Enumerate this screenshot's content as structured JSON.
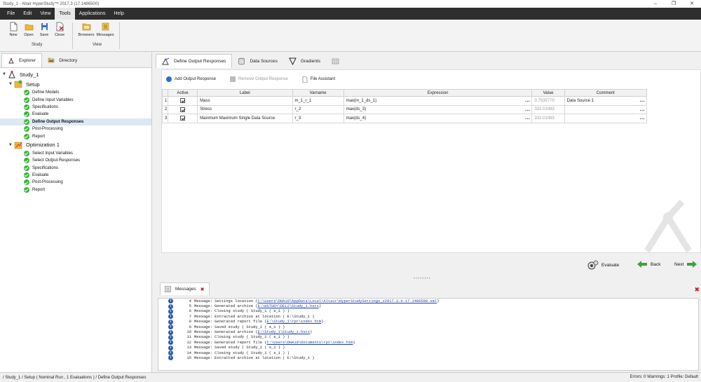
{
  "window": {
    "title": "Study_1 - Altair HyperStudy™ 2017.3 (17.1486500)"
  },
  "menu": [
    "File",
    "Edit",
    "View",
    "Tools",
    "Applications",
    "Help"
  ],
  "toolbar": {
    "study_buttons": [
      "New",
      "Open",
      "Save",
      "Close"
    ],
    "study_group": "Study",
    "view_buttons": [
      "Browsers",
      "Messages"
    ],
    "view_group": "View"
  },
  "left_tabs": [
    "Explorer",
    "Directory"
  ],
  "tree": {
    "root": "Study_1",
    "setup": {
      "label": "Setup",
      "items": [
        "Define Models",
        "Define Input Variables",
        "Specifications",
        "Evaluate",
        "Define Output Responses",
        "Post-Processing",
        "Report"
      ]
    },
    "optimization": {
      "label": "Optimization 1",
      "items": [
        "Select Input Variables",
        "Select Output Responses",
        "Specifications",
        "Evaluate",
        "Post-Processing",
        "Report"
      ]
    }
  },
  "main_tabs": [
    "Define Output Responses",
    "Data Sources",
    "Gradients"
  ],
  "actions": {
    "add": "Add Output Response",
    "remove": "Remove Output Response",
    "file_assistant": "File Assistant"
  },
  "grid": {
    "headers": [
      "Active",
      "Label",
      "Varname",
      "Expression",
      "Value",
      "Comment"
    ],
    "rows": [
      {
        "num": "1",
        "label": "Mass",
        "varname": "m_1_r_1",
        "expression": "max(m_1_ds_1)",
        "value": "0.7535770",
        "comment": "Data Source 1"
      },
      {
        "num": "2",
        "label": "Stress",
        "varname": "r_2",
        "expression": "max(ds_3)",
        "value": "332.01083",
        "comment": ""
      },
      {
        "num": "3",
        "label": "Maximum Maximum Single Data Source",
        "varname": "r_3",
        "expression": "max(ds_4)",
        "value": "332.01083",
        "comment": ""
      }
    ],
    "dots": "..."
  },
  "nav": {
    "evaluate": "Evaluate",
    "back": "Back",
    "next": "Next"
  },
  "messages": {
    "tab": "Messages",
    "lines": [
      {
        "n": "4",
        "pre": "Message: Settings location ( ",
        "link": "C:\\Users\\DHA10\\AppData\\Local\\Altair\\HyperStudySettings_v2017.3.0.17.1486500.xml",
        "post": " )"
      },
      {
        "n": "5",
        "pre": "Message: Generated archive ( ",
        "link": "E:\\HSTUDY\\DEL2\\Study_1.hstx",
        "post": " )"
      },
      {
        "n": "6",
        "pre": "Message: Closing study ( Study_1 ( s_1 ) )",
        "link": "",
        "post": ""
      },
      {
        "n": "7",
        "pre": "Message: Extracted archive at location ( E:\\Study_1 )",
        "link": "",
        "post": ""
      },
      {
        "n": "8",
        "pre": "Message: Generated report file ( ",
        "link": "E:\\Study_1\\rpt\\index.htm",
        "post": " )"
      },
      {
        "n": "9",
        "pre": "Message: Saved study ( Study_1 ( s_1 ) )",
        "link": "",
        "post": ""
      },
      {
        "n": "10",
        "pre": "Message: Generated archive ( ",
        "link": "E:\\Study_1\\Study_1.hstx",
        "post": " )"
      },
      {
        "n": "11",
        "pre": "Message: Closing study ( Study_1 ( s_1 ) )",
        "link": "",
        "post": ""
      },
      {
        "n": "12",
        "pre": "Message: Generated report file ( ",
        "link": "C:\\Users\\DHA10\\Documents\\rpt\\index.htm",
        "post": " )"
      },
      {
        "n": "13",
        "pre": "Message: Saved study ( Study_1 ( s_1 ) )",
        "link": "",
        "post": ""
      },
      {
        "n": "14",
        "pre": "Message: Closing study ( Study_1 ( s_1 ) )",
        "link": "",
        "post": ""
      },
      {
        "n": "15",
        "pre": "Message: Extracted archive at location ( E:\\Study_1 )",
        "link": "",
        "post": ""
      }
    ]
  },
  "status": {
    "path": "/ Study_1 / Setup ( Nominal Run , 1 Evaluations ) / Define Output Responses",
    "right": "Errors: 0   Warnings: 1     Profile: Default"
  }
}
